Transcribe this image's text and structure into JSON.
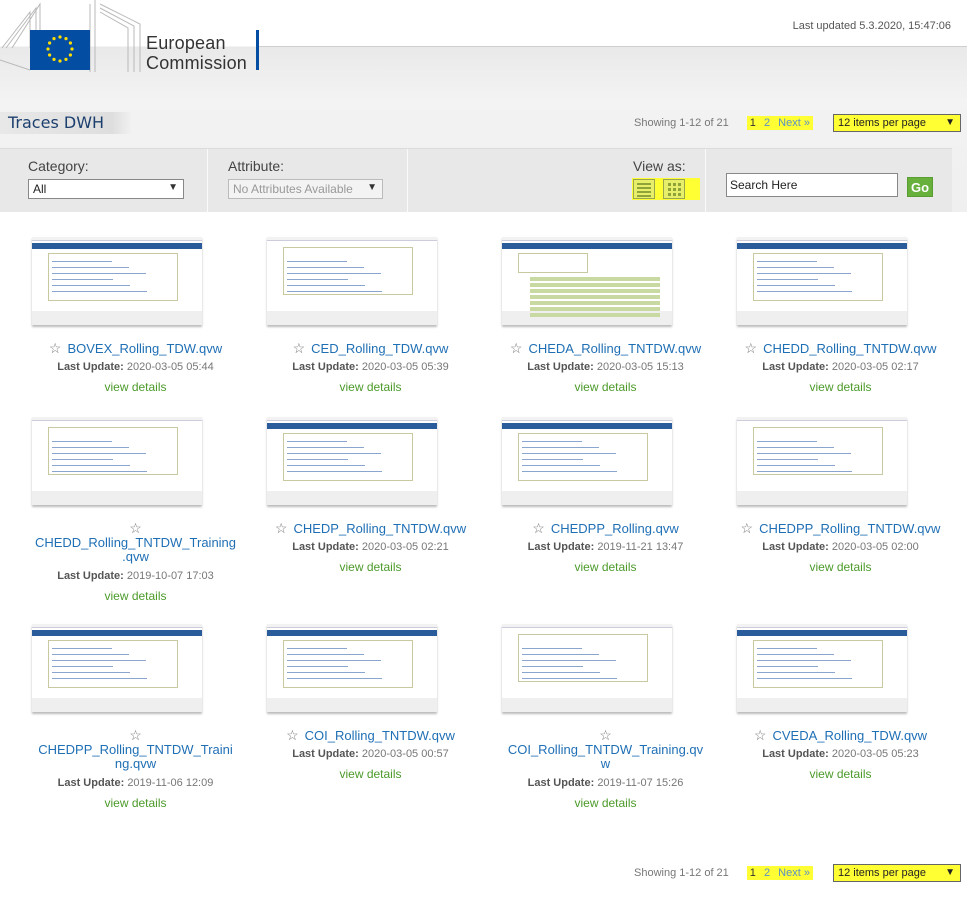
{
  "header": {
    "logo_line1": "European",
    "logo_line2": "Commission",
    "last_updated": "Last updated 5.3.2020, 15:47:06"
  },
  "page_title": "Traces DWH",
  "pagination": {
    "showing": "Showing 1-12 of 21",
    "pages": [
      "1",
      "2"
    ],
    "next": "Next »",
    "per_page": "12 items per page"
  },
  "filters": {
    "category_label": "Category:",
    "category_value": "All",
    "attribute_label": "Attribute:",
    "attribute_value": "No Attributes Available",
    "view_as_label": "View as:",
    "search_value": "Search Here",
    "go_label": "Go"
  },
  "labels": {
    "last_update": "Last Update:",
    "view_details": "view details"
  },
  "colors": {
    "link": "#1f6fb5",
    "details_link": "#4c9a2a",
    "highlight": "#ffff33",
    "go_button": "#67b03c"
  },
  "documents": [
    {
      "name": "BOVEX_Rolling_TDW.qvw",
      "date": "2020-03-05 05:44"
    },
    {
      "name": "CED_Rolling_TDW.qvw",
      "date": "2020-03-05 05:39"
    },
    {
      "name": "CHEDA_Rolling_TNTDW.qvw",
      "date": "2020-03-05 15:13"
    },
    {
      "name": "CHEDD_Rolling_TNTDW.qvw",
      "date": "2020-03-05 02:17"
    },
    {
      "name": "CHEDD_Rolling_TNTDW_Training",
      "name2": ".qvw",
      "date": "2019-10-07 17:03"
    },
    {
      "name": "CHEDP_Rolling_TNTDW.qvw",
      "date": "2020-03-05 02:21"
    },
    {
      "name": "CHEDPP_Rolling.qvw",
      "date": "2019-11-21 13:47"
    },
    {
      "name": "CHEDPP_Rolling_TNTDW.qvw",
      "date": "2020-03-05 02:00"
    },
    {
      "name": "CHEDPP_Rolling_TNTDW_Traini",
      "name2": "ng.qvw",
      "date": "2019-11-06 12:09"
    },
    {
      "name": "COI_Rolling_TNTDW.qvw",
      "date": "2020-03-05 00:57"
    },
    {
      "name": "COI_Rolling_TNTDW_Training.qv",
      "name2": "w",
      "date": "2019-11-07 15:26"
    },
    {
      "name": "CVEDA_Rolling_TDW.qvw",
      "date": "2020-03-05 05:23"
    }
  ]
}
